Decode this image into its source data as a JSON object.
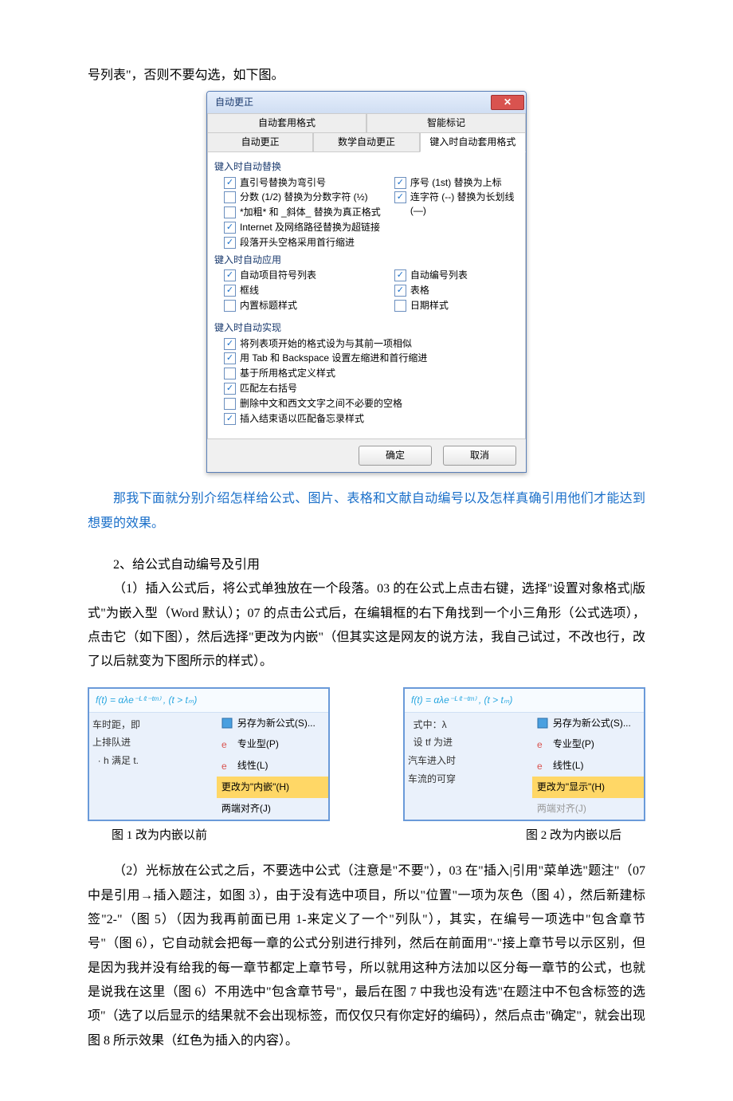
{
  "top_line": "号列表\"，否则不要勾选，如下图。",
  "dialog": {
    "title": "自动更正",
    "tab_top1": "自动套用格式",
    "tab_top2": "智能标记",
    "tab_bot1": "自动更正",
    "tab_bot2": "数学自动更正",
    "tab_bot3": "键入时自动套用格式",
    "sec1": "键入时自动替换",
    "sec2": "键入时自动应用",
    "sec3": "键入时自动实现",
    "s1": [
      {
        "l": "直引号替换为弯引号",
        "c": true
      },
      {
        "l": "分数 (1/2) 替换为分数字符 (½)",
        "c": false
      },
      {
        "l": "*加粗* 和 _斜体_ 替换为真正格式",
        "c": false
      },
      {
        "l": "Internet 及网络路径替换为超链接",
        "c": true
      },
      {
        "l": "段落开头空格采用首行缩进",
        "c": true
      }
    ],
    "s1r": [
      {
        "l": "序号 (1st) 替换为上标",
        "c": true
      },
      {
        "l": "连字符 (--) 替换为长划线 (—)",
        "c": true
      }
    ],
    "s2": [
      {
        "l": "自动项目符号列表",
        "c": true
      },
      {
        "l": "框线",
        "c": true
      },
      {
        "l": "内置标题样式",
        "c": false
      }
    ],
    "s2r": [
      {
        "l": "自动编号列表",
        "c": true
      },
      {
        "l": "表格",
        "c": true
      },
      {
        "l": "日期样式",
        "c": false
      }
    ],
    "s3": [
      {
        "l": "将列表项开始的格式设为与其前一项相似",
        "c": true
      },
      {
        "l": "用 Tab 和 Backspace 设置左缩进和首行缩进",
        "c": true
      },
      {
        "l": "基于所用格式定义样式",
        "c": false
      },
      {
        "l": "匹配左右括号",
        "c": true
      },
      {
        "l": "删除中文和西文文字之间不必要的空格",
        "c": false
      },
      {
        "l": "插入结束语以匹配备忘录样式",
        "c": true
      }
    ],
    "btn_ok": "确定",
    "btn_cancel": "取消"
  },
  "blue_para": "那我下面就分别介绍怎样给公式、图片、表格和文献自动编号以及怎样真确引用他们才能达到想要的效果。",
  "heading2": "2、给公式自动编号及引用",
  "para1": "（1）插入公式后，将公式单独放在一个段落。03 的在公式上点击右键，选择\"设置对象格式|版式\"为嵌入型（Word 默认）；07 的点击公式后，在编辑框的右下角找到一个小三角形（公式选项），点击它（如下图），然后选择\"更改为内嵌\"（但其实这是网友的说方法，我自己试过，不改也行，改了以后就变为下图所示的样式）。",
  "formula": "f(t) = αλe⁻ᴸ⁽ᵗ⁻ᵗᵐ⁾ , (t > tₘ)",
  "fig1_left_lines": "车时距，即\n上排队进\n  · h 满足 t.",
  "fig2_left_lines": "  式中：λ\n  设 tf 为进\n汽车进入时\n车流的可穿",
  "menu": {
    "m1": "另存为新公式(S)...",
    "m2": "专业型(P)",
    "m3": "线性(L)",
    "m4a": "更改为\"内嵌\"(H)",
    "m4b": "更改为\"显示\"(H)",
    "m5": "两端对齐(J)"
  },
  "caption1": "图 1 改为内嵌以前",
  "caption2": "图 2  改为内嵌以后",
  "para2": "（2）光标放在公式之后，不要选中公式（注意是\"不要\"），03 在\"插入|引用\"菜单选\"题注\"（07 中是引用→插入题注，如图 3），由于没有选中项目，所以\"位置\"一项为灰色（图 4），然后新建标签\"2-\"（图 5）（因为我再前面已用 1-来定义了一个\"列队\"），其实，在编号一项选中\"包含章节号\"（图 6），它自动就会把每一章的公式分别进行排列，然后在前面用\"-\"接上章节号以示区别，但是因为我并没有给我的每一章节都定上章节号，所以就用这种方法加以区分每一章节的公式，也就是说我在这里（图 6）不用选中\"包含章节号\"，最后在图 7 中我也没有选\"在题注中不包含标签的选项\"（选了以后显示的结果就不会出现标签，而仅仅只有你定好的编码），然后点击\"确定\"，就会出现图 8 所示效果（红色为插入的内容）。"
}
